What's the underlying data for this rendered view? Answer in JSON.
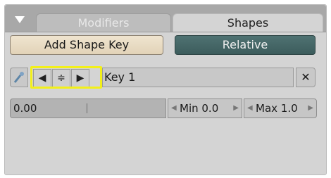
{
  "tabs": {
    "modifiers": "Modifiers",
    "shapes": "Shapes"
  },
  "buttons": {
    "add_shape_key": "Add Shape Key",
    "relative": "Relative"
  },
  "shape_key": {
    "prev_glyph": "◀",
    "menu_glyph": "≑",
    "next_glyph": "▶",
    "name": "Key 1",
    "delete_glyph": "✕"
  },
  "value_row": {
    "value": "0.00",
    "min_label": "Min 0.0",
    "max_label": "Max 1.0"
  },
  "colors": {
    "panel_bg": "#d4d4d4",
    "header_bg": "#a8a8a8",
    "relative_button": "#456767",
    "add_button": "#e8dcc4",
    "highlight": "#f3f019"
  },
  "icons": {
    "collapse": "triangle-down-icon",
    "pin": "pin-icon"
  }
}
